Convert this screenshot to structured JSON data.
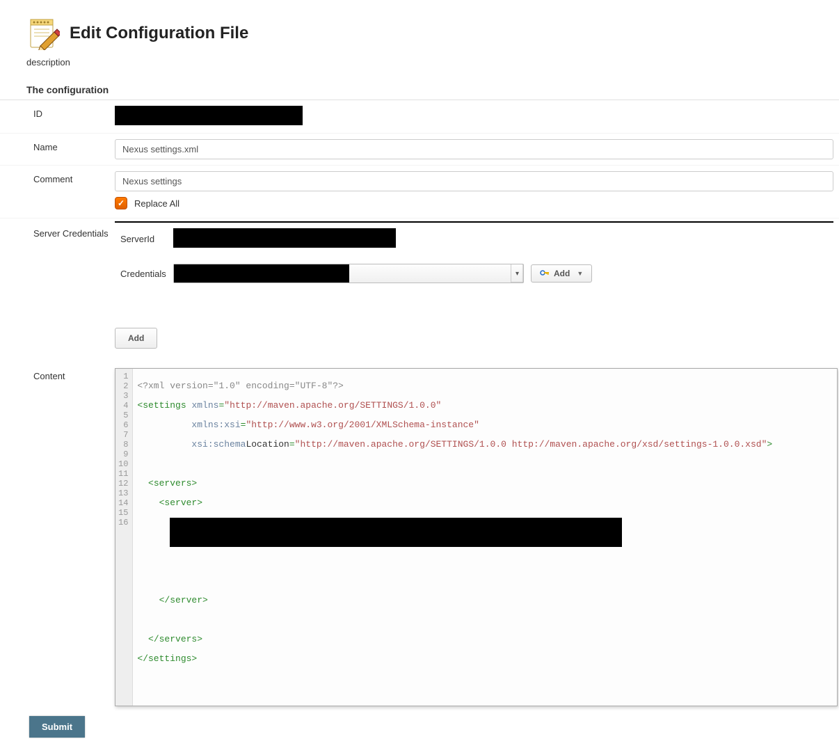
{
  "header": {
    "title": "Edit Configuration File",
    "description_label": "description"
  },
  "section": {
    "title": "The configuration"
  },
  "form": {
    "id_label": "ID",
    "id_value_redacted": true,
    "name_label": "Name",
    "name_value": "Nexus settings.xml",
    "comment_label": "Comment",
    "comment_value": "Nexus settings",
    "replace_all_label": "Replace All",
    "replace_all_checked": true,
    "server_creds_label": "Server Credentials",
    "server_id_label": "ServerId",
    "credentials_label": "Credentials",
    "add_credential_label": "Add",
    "add_server_label": "Add",
    "content_label": "Content"
  },
  "code": {
    "lines": [
      "1",
      "2",
      "3",
      "4",
      "5",
      "6",
      "7",
      "8",
      "9",
      "10",
      "11",
      "12",
      "13",
      "14",
      "15",
      "16"
    ],
    "xml_decl": "<?xml version=\"1.0\" encoding=\"UTF-8\"?>",
    "settings_open": "settings",
    "xmlns_attr": "xmlns",
    "xmlns_val": "\"http://maven.apache.org/SETTINGS/1.0.0\"",
    "xmlns_xsi_attr": "xmlns:xsi",
    "xmlns_xsi_val": "\"http://www.w3.org/2001/XMLSchema-instance\"",
    "schemaloc_attr": "xsi:schemaLocation",
    "schemaloc_val": "\"http://maven.apache.org/SETTINGS/1.0.0 http://maven.apache.org/xsd/settings-1.0.0.xsd\"",
    "servers_open": "<servers>",
    "server_open": "<server>",
    "server_close": "</server>",
    "servers_close": "</servers>",
    "settings_close": "</settings>"
  },
  "footer": {
    "submit_label": "Submit"
  }
}
